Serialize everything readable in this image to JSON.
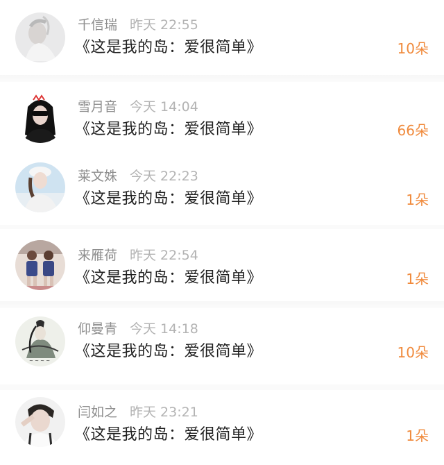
{
  "gifts": [
    {
      "user": "千信瑞",
      "time": "昨天 22:55",
      "title": "《这是我的岛：爱很简单》",
      "count": "10朵",
      "avatar": "avatar-girl-white"
    },
    {
      "user": "雪月音",
      "time": "今天 14:04",
      "title": "《这是我的岛：爱很简单》",
      "count": "66朵",
      "avatar": "avatar-girl-sunglasses"
    },
    {
      "user": "莱文姝",
      "time": "今天 22:23",
      "title": "《这是我的岛：爱很简单》",
      "count": "1朵",
      "avatar": "avatar-girl-cap"
    },
    {
      "user": "来雁荷",
      "time": "昨天 22:54",
      "title": "《这是我的岛：爱很简单》",
      "count": "1朵",
      "avatar": "avatar-two-kids"
    },
    {
      "user": "仰曼青",
      "time": "今天 14:18",
      "title": "《这是我的岛：爱很简单》",
      "count": "10朵",
      "avatar": "avatar-ink-painting"
    },
    {
      "user": "闫如之",
      "time": "昨天 23:21",
      "title": "《这是我的岛：爱很简单》",
      "count": "1朵",
      "avatar": "avatar-boy"
    }
  ],
  "colors": {
    "count": "#f08a3c",
    "meta": "#9a9a9a",
    "title": "#1f1f1f"
  }
}
